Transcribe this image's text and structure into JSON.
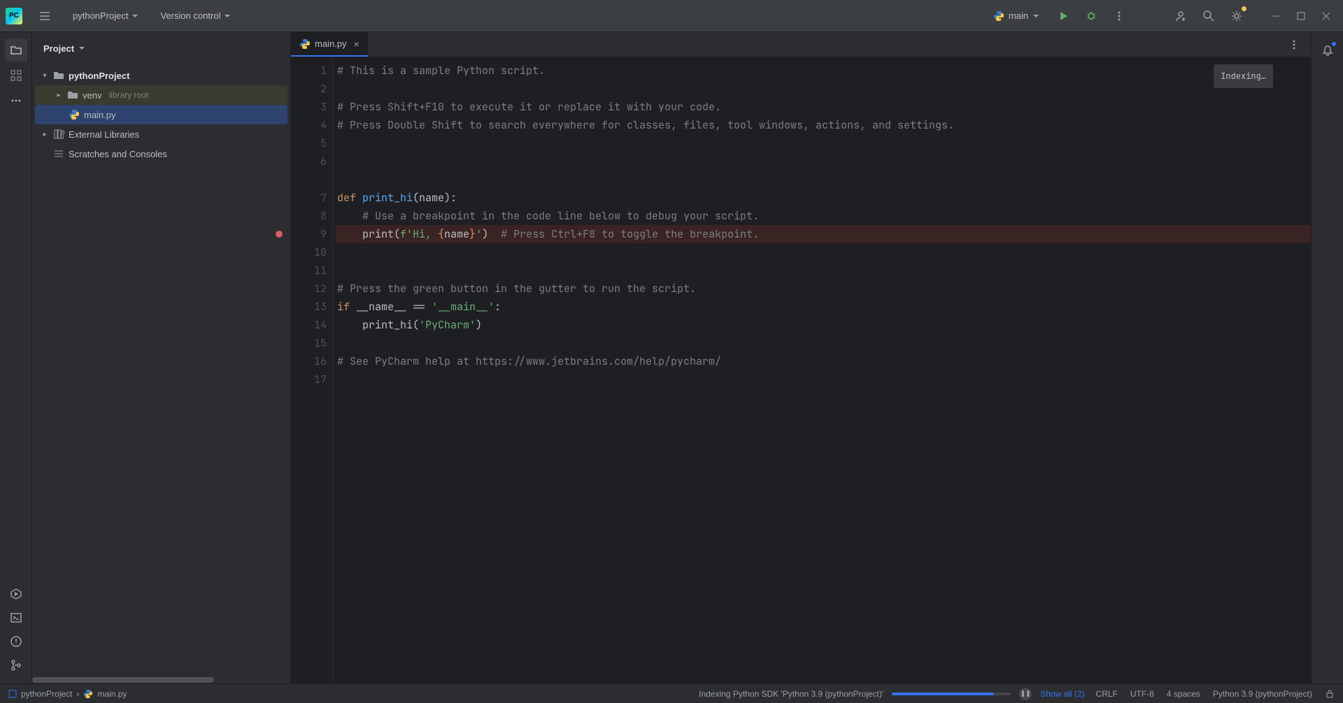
{
  "toolbar": {
    "project_name": "pythonProject",
    "vcs_label": "Version control",
    "run_config": "main"
  },
  "project_panel": {
    "title": "Project",
    "root": "pythonProject",
    "venv": "venv",
    "venv_hint": "library root",
    "main_file": "main.py",
    "ext_libs": "External Libraries",
    "scratches": "Scratches and Consoles"
  },
  "tabs": {
    "active": "main.py",
    "indexing": "Indexing…"
  },
  "code": {
    "lines": [
      {
        "n": 1,
        "type": "comment",
        "text": "# This is a sample Python script."
      },
      {
        "n": 2,
        "type": "blank",
        "text": ""
      },
      {
        "n": 3,
        "type": "comment",
        "text": "# Press Shift+F10 to execute it or replace it with your code."
      },
      {
        "n": 4,
        "type": "comment",
        "text": "# Press Double Shift to search everywhere for classes, files, tool windows, actions, and settings."
      },
      {
        "n": 5,
        "type": "blank",
        "text": ""
      },
      {
        "n": 6,
        "type": "blank",
        "text": "",
        "extra": true
      },
      {
        "n": 7,
        "type": "def",
        "kw": "def ",
        "name": "print_hi",
        "rest": "(name):"
      },
      {
        "n": 8,
        "type": "comment",
        "text": "    # Use a breakpoint in the code line below to debug your script."
      },
      {
        "n": 9,
        "type": "print",
        "bp": true,
        "indent": "    ",
        "call": "print(",
        "fpre": "f'",
        "str1": "Hi, ",
        "lb": "{",
        "var": "name",
        "rb": "}",
        "str2": "'",
        "close": ")",
        "trail": "  # Press Ctrl+F8 to toggle the breakpoint."
      },
      {
        "n": 10,
        "type": "blank",
        "text": ""
      },
      {
        "n": 11,
        "type": "blank",
        "text": ""
      },
      {
        "n": 12,
        "type": "comment",
        "text": "# Press the green button in the gutter to run the script."
      },
      {
        "n": 13,
        "type": "ifmain",
        "kw": "if ",
        "dunder": "__name__",
        "eq": " == ",
        "str": "'__main__'",
        "colon": ":"
      },
      {
        "n": 14,
        "type": "call",
        "indent": "    ",
        "fn": "print_hi(",
        "arg": "'PyCharm'",
        "close": ")"
      },
      {
        "n": 15,
        "type": "blank",
        "text": ""
      },
      {
        "n": 16,
        "type": "comment",
        "text": "# See PyCharm help at https://www.jetbrains.com/help/pycharm/"
      },
      {
        "n": 17,
        "type": "blank",
        "text": ""
      }
    ]
  },
  "status": {
    "crumb_project": "pythonProject",
    "crumb_file": "main.py",
    "indexing_msg": "Indexing Python SDK 'Python 3.9 (pythonProject)'",
    "show_all": "Show all (2)",
    "line_sep": "CRLF",
    "encoding": "UTF-8",
    "indent": "4 spaces",
    "interpreter": "Python 3.9 (pythonProject)"
  }
}
